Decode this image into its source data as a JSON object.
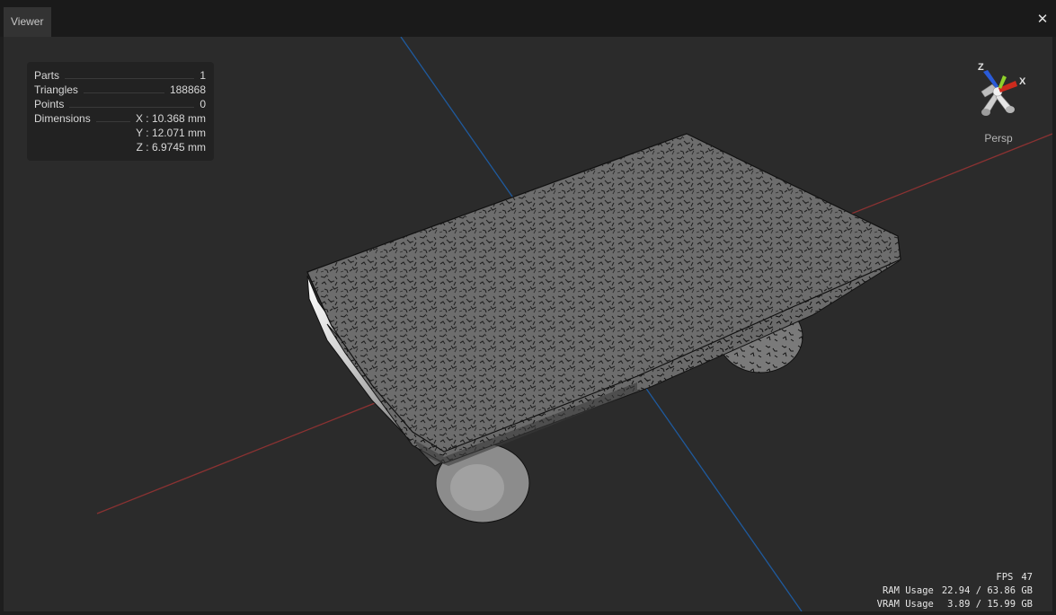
{
  "window": {
    "tab_label": "Viewer",
    "close_icon": "close-icon"
  },
  "info": {
    "parts_label": "Parts",
    "parts_value": "1",
    "triangles_label": "Triangles",
    "triangles_value": "188868",
    "points_label": "Points",
    "points_value": "0",
    "dimensions_label": "Dimensions",
    "dim_x": "X : 10.368 mm",
    "dim_y": "Y : 12.071 mm",
    "dim_z": "Z : 6.9745 mm"
  },
  "gizmo": {
    "z_label": "Z",
    "x_label": "X",
    "view_mode": "Persp",
    "colors": {
      "x": "#cc2b1d",
      "y": "#8fd12a",
      "z": "#2a5bd9"
    }
  },
  "stats": {
    "fps_label": "FPS",
    "fps_value": "47",
    "ram_label": "RAM Usage",
    "ram_value": "22.94 / 63.86 GB",
    "vram_label": "VRAM Usage",
    "vram_value": " 3.89 / 15.99 GB"
  },
  "axes_colors": {
    "x_axis": "#8a3232",
    "z_axis": "#1f5a9e"
  }
}
